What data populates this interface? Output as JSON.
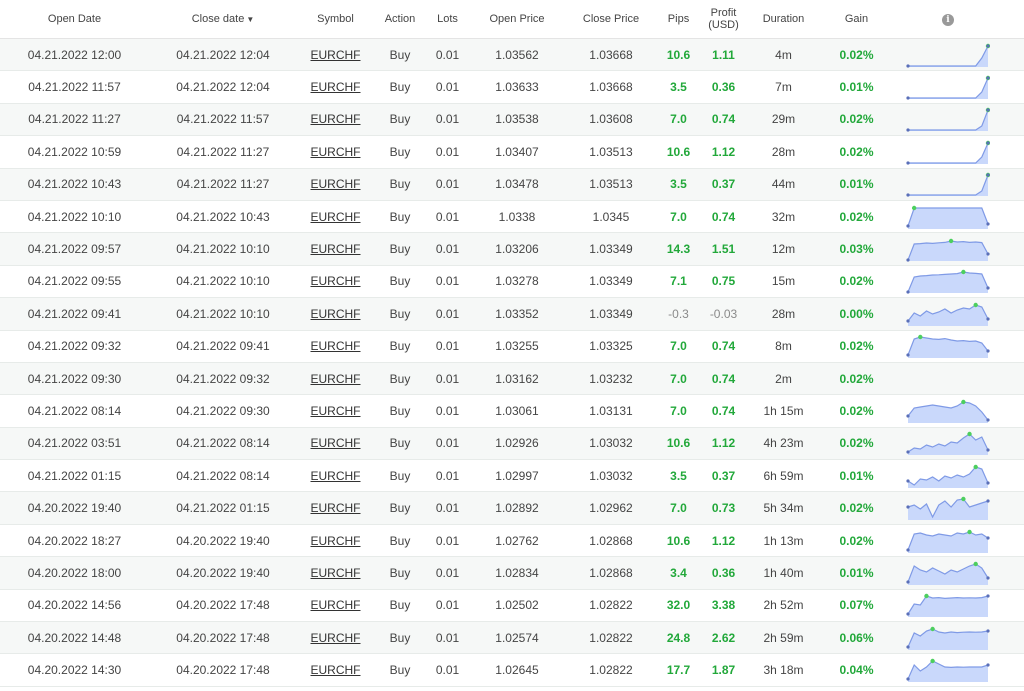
{
  "headers": {
    "open_date": "Open Date",
    "close_date": "Close date",
    "sort_arrow": "▼",
    "symbol": "Symbol",
    "action": "Action",
    "lots": "Lots",
    "open_price": "Open Price",
    "close_price": "Close Price",
    "pips": "Pips",
    "profit": "Profit",
    "profit_unit": "(USD)",
    "duration": "Duration",
    "gain": "Gain",
    "info_icon": "i"
  },
  "colors": {
    "positive": "#22a83a",
    "neutral": "#8a8a8a",
    "spark_fill": "#c9d8fb",
    "spark_line": "#7f9ae6",
    "spark_dot": "#4ccf5e"
  },
  "rows": [
    {
      "open": "04.21.2022 12:00",
      "close": "04.21.2022 12:04",
      "symbol": "EURCHF",
      "action": "Buy",
      "lots": "0.01",
      "open_price": "1.03562",
      "close_price": "1.03668",
      "pips": "10.6",
      "profit": "1.11",
      "duration": "4m",
      "gain": "0.02%",
      "trend": [
        0,
        0,
        0,
        0,
        0,
        0,
        0,
        0,
        0,
        0,
        0,
        0,
        0.4,
        1
      ]
    },
    {
      "open": "04.21.2022 11:57",
      "close": "04.21.2022 12:04",
      "symbol": "EURCHF",
      "action": "Buy",
      "lots": "0.01",
      "open_price": "1.03633",
      "close_price": "1.03668",
      "pips": "3.5",
      "profit": "0.36",
      "duration": "7m",
      "gain": "0.01%",
      "trend": [
        0,
        0,
        0,
        0,
        0,
        0,
        0,
        0,
        0,
        0,
        0,
        0,
        0.3,
        1
      ]
    },
    {
      "open": "04.21.2022 11:27",
      "close": "04.21.2022 11:57",
      "symbol": "EURCHF",
      "action": "Buy",
      "lots": "0.01",
      "open_price": "1.03538",
      "close_price": "1.03608",
      "pips": "7.0",
      "profit": "0.74",
      "duration": "29m",
      "gain": "0.02%",
      "trend": [
        0,
        0,
        0,
        0,
        0,
        0,
        0,
        0,
        0,
        0,
        0,
        0,
        0.2,
        1
      ]
    },
    {
      "open": "04.21.2022 10:59",
      "close": "04.21.2022 11:27",
      "symbol": "EURCHF",
      "action": "Buy",
      "lots": "0.01",
      "open_price": "1.03407",
      "close_price": "1.03513",
      "pips": "10.6",
      "profit": "1.12",
      "duration": "28m",
      "gain": "0.02%",
      "trend": [
        0,
        0,
        0,
        0,
        0,
        0,
        0,
        0,
        0,
        0,
        0,
        0,
        0.3,
        1
      ]
    },
    {
      "open": "04.21.2022 10:43",
      "close": "04.21.2022 11:27",
      "symbol": "EURCHF",
      "action": "Buy",
      "lots": "0.01",
      "open_price": "1.03478",
      "close_price": "1.03513",
      "pips": "3.5",
      "profit": "0.37",
      "duration": "44m",
      "gain": "0.01%",
      "trend": [
        0,
        0,
        0,
        0,
        0,
        0,
        0,
        0,
        0,
        0,
        0,
        0,
        0.2,
        1
      ]
    },
    {
      "open": "04.21.2022 10:10",
      "close": "04.21.2022 10:43",
      "symbol": "EURCHF",
      "action": "Buy",
      "lots": "0.01",
      "open_price": "1.0338",
      "close_price": "1.0345",
      "pips": "7.0",
      "profit": "0.74",
      "duration": "32m",
      "gain": "0.02%",
      "trend": [
        0.1,
        1,
        1,
        1,
        1,
        1,
        1,
        1,
        1,
        1,
        1,
        1,
        1,
        0.2
      ]
    },
    {
      "open": "04.21.2022 09:57",
      "close": "04.21.2022 10:10",
      "symbol": "EURCHF",
      "action": "Buy",
      "lots": "0.01",
      "open_price": "1.03206",
      "close_price": "1.03349",
      "pips": "14.3",
      "profit": "1.51",
      "duration": "12m",
      "gain": "0.03%",
      "trend": [
        0,
        0.8,
        0.82,
        0.85,
        0.83,
        0.86,
        0.88,
        0.95,
        0.9,
        0.92,
        0.88,
        0.9,
        0.87,
        0.3
      ]
    },
    {
      "open": "04.21.2022 09:55",
      "close": "04.21.2022 10:10",
      "symbol": "EURCHF",
      "action": "Buy",
      "lots": "0.01",
      "open_price": "1.03278",
      "close_price": "1.03349",
      "pips": "7.1",
      "profit": "0.75",
      "duration": "15m",
      "gain": "0.02%",
      "trend": [
        0,
        0.75,
        0.8,
        0.82,
        0.85,
        0.86,
        0.88,
        0.9,
        0.92,
        1,
        0.95,
        0.93,
        0.9,
        0.2
      ]
    },
    {
      "open": "04.21.2022 09:41",
      "close": "04.21.2022 10:10",
      "symbol": "EURCHF",
      "action": "Buy",
      "lots": "0.01",
      "open_price": "1.03352",
      "close_price": "1.03349",
      "pips": "-0.3",
      "profit": "-0.03",
      "duration": "28m",
      "gain": "0.00%",
      "trend": [
        0.2,
        0.6,
        0.45,
        0.7,
        0.55,
        0.65,
        0.8,
        0.6,
        0.75,
        0.85,
        0.8,
        1,
        0.9,
        0.3
      ]
    },
    {
      "open": "04.21.2022 09:32",
      "close": "04.21.2022 09:41",
      "symbol": "EURCHF",
      "action": "Buy",
      "lots": "0.01",
      "open_price": "1.03255",
      "close_price": "1.03325",
      "pips": "7.0",
      "profit": "0.74",
      "duration": "8m",
      "gain": "0.02%",
      "trend": [
        0.1,
        0.9,
        1,
        0.95,
        0.9,
        0.88,
        0.92,
        0.85,
        0.8,
        0.82,
        0.78,
        0.8,
        0.7,
        0.3
      ]
    },
    {
      "open": "04.21.2022 09:30",
      "close": "04.21.2022 09:32",
      "symbol": "EURCHF",
      "action": "Buy",
      "lots": "0.01",
      "open_price": "1.03162",
      "close_price": "1.03232",
      "pips": "7.0",
      "profit": "0.74",
      "duration": "2m",
      "gain": "0.02%",
      "trend": []
    },
    {
      "open": "04.21.2022 08:14",
      "close": "04.21.2022 09:30",
      "symbol": "EURCHF",
      "action": "Buy",
      "lots": "0.01",
      "open_price": "1.03061",
      "close_price": "1.03131",
      "pips": "7.0",
      "profit": "0.74",
      "duration": "1h 15m",
      "gain": "0.02%",
      "trend": [
        0.3,
        0.7,
        0.75,
        0.8,
        0.85,
        0.8,
        0.75,
        0.7,
        0.8,
        1,
        0.95,
        0.8,
        0.5,
        0.1
      ]
    },
    {
      "open": "04.21.2022 03:51",
      "close": "04.21.2022 08:14",
      "symbol": "EURCHF",
      "action": "Buy",
      "lots": "0.01",
      "open_price": "1.02926",
      "close_price": "1.03032",
      "pips": "10.6",
      "profit": "1.12",
      "duration": "4h 23m",
      "gain": "0.02%",
      "trend": [
        0.1,
        0.3,
        0.25,
        0.45,
        0.35,
        0.5,
        0.4,
        0.6,
        0.55,
        0.8,
        1,
        0.7,
        0.85,
        0.2
      ]
    },
    {
      "open": "04.21.2022 01:15",
      "close": "04.21.2022 08:14",
      "symbol": "EURCHF",
      "action": "Buy",
      "lots": "0.01",
      "open_price": "1.02997",
      "close_price": "1.03032",
      "pips": "3.5",
      "profit": "0.37",
      "duration": "6h 59m",
      "gain": "0.01%",
      "trend": [
        0.3,
        0.1,
        0.4,
        0.35,
        0.5,
        0.3,
        0.55,
        0.45,
        0.6,
        0.5,
        0.65,
        1,
        0.9,
        0.2
      ]
    },
    {
      "open": "04.20.2022 19:40",
      "close": "04.21.2022 01:15",
      "symbol": "EURCHF",
      "action": "Buy",
      "lots": "0.01",
      "open_price": "1.02892",
      "close_price": "1.02962",
      "pips": "7.0",
      "profit": "0.73",
      "duration": "5h 34m",
      "gain": "0.02%",
      "trend": [
        0.6,
        0.7,
        0.5,
        0.75,
        0.1,
        0.7,
        0.9,
        0.6,
        0.95,
        1,
        0.6,
        0.7,
        0.8,
        0.9
      ]
    },
    {
      "open": "04.20.2022 18:27",
      "close": "04.20.2022 19:40",
      "symbol": "EURCHF",
      "action": "Buy",
      "lots": "0.01",
      "open_price": "1.02762",
      "close_price": "1.02868",
      "pips": "10.6",
      "profit": "1.12",
      "duration": "1h 13m",
      "gain": "0.02%",
      "trend": [
        0.1,
        0.9,
        0.95,
        0.85,
        0.8,
        0.9,
        0.85,
        0.8,
        0.95,
        0.9,
        1,
        0.85,
        0.9,
        0.7
      ]
    },
    {
      "open": "04.20.2022 18:00",
      "close": "04.20.2022 19:40",
      "symbol": "EURCHF",
      "action": "Buy",
      "lots": "0.01",
      "open_price": "1.02834",
      "close_price": "1.02868",
      "pips": "3.4",
      "profit": "0.36",
      "duration": "1h 40m",
      "gain": "0.01%",
      "trend": [
        0.1,
        0.9,
        0.7,
        0.6,
        0.8,
        0.65,
        0.5,
        0.7,
        0.6,
        0.75,
        0.9,
        1,
        0.8,
        0.3
      ]
    },
    {
      "open": "04.20.2022 14:56",
      "close": "04.20.2022 17:48",
      "symbol": "EURCHF",
      "action": "Buy",
      "lots": "0.01",
      "open_price": "1.02502",
      "close_price": "1.02822",
      "pips": "32.0",
      "profit": "3.38",
      "duration": "2h 52m",
      "gain": "0.07%",
      "trend": [
        0.1,
        0.6,
        0.55,
        1,
        0.9,
        0.92,
        0.88,
        0.9,
        0.92,
        0.9,
        0.91,
        0.9,
        0.92,
        1
      ]
    },
    {
      "open": "04.20.2022 14:48",
      "close": "04.20.2022 17:48",
      "symbol": "EURCHF",
      "action": "Buy",
      "lots": "0.01",
      "open_price": "1.02574",
      "close_price": "1.02822",
      "pips": "24.8",
      "profit": "2.62",
      "duration": "2h 59m",
      "gain": "0.06%",
      "trend": [
        0.1,
        0.8,
        0.65,
        0.9,
        1,
        0.85,
        0.8,
        0.85,
        0.82,
        0.84,
        0.85,
        0.84,
        0.85,
        0.9
      ]
    },
    {
      "open": "04.20.2022 14:30",
      "close": "04.20.2022 17:48",
      "symbol": "EURCHF",
      "action": "Buy",
      "lots": "0.01",
      "open_price": "1.02645",
      "close_price": "1.02822",
      "pips": "17.7",
      "profit": "1.87",
      "duration": "3h 18m",
      "gain": "0.04%",
      "trend": [
        0.1,
        0.8,
        0.5,
        0.7,
        1,
        0.85,
        0.7,
        0.68,
        0.7,
        0.69,
        0.7,
        0.7,
        0.7,
        0.8
      ]
    }
  ]
}
